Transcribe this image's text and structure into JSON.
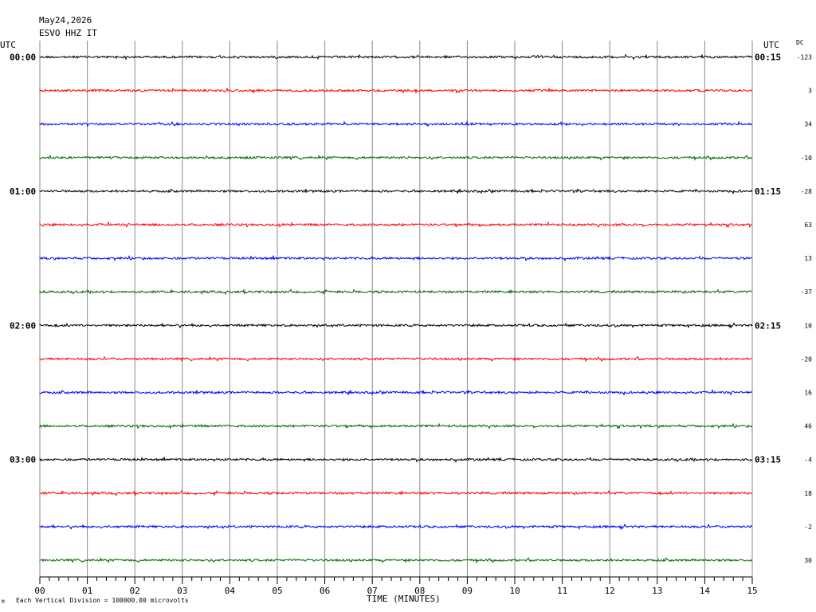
{
  "header": {
    "date": "May24,2026",
    "station": "ESVO HHZ IT",
    "left_tz": "UTC",
    "right_tz": "UTC",
    "dc_label": "DC"
  },
  "footer": {
    "scale_note": "Each Vertical Division = 100000.00 microvolts",
    "corner_mark": "M"
  },
  "chart_data": {
    "type": "line",
    "title": "ESVO HHZ IT",
    "xlabel": "TIME (MINUTES)",
    "ylabel": "",
    "xlim": [
      0,
      15
    ],
    "x_ticks": [
      "00",
      "01",
      "02",
      "03",
      "04",
      "05",
      "06",
      "07",
      "08",
      "09",
      "10",
      "11",
      "12",
      "13",
      "14",
      "15"
    ],
    "trace_colors": [
      "#000000",
      "#ff0000",
      "#0000ff",
      "#006400"
    ],
    "grid": true,
    "rows": [
      {
        "left_label": "00:00",
        "right_label": "00:15",
        "dc": "-123"
      },
      {
        "left_label": "",
        "right_label": "",
        "dc": "3"
      },
      {
        "left_label": "",
        "right_label": "",
        "dc": "34"
      },
      {
        "left_label": "",
        "right_label": "",
        "dc": "-10"
      },
      {
        "left_label": "01:00",
        "right_label": "01:15",
        "dc": "-28"
      },
      {
        "left_label": "",
        "right_label": "",
        "dc": "63"
      },
      {
        "left_label": "",
        "right_label": "",
        "dc": "13"
      },
      {
        "left_label": "",
        "right_label": "",
        "dc": "-37"
      },
      {
        "left_label": "02:00",
        "right_label": "02:15",
        "dc": "10"
      },
      {
        "left_label": "",
        "right_label": "",
        "dc": "-20"
      },
      {
        "left_label": "",
        "right_label": "",
        "dc": "16"
      },
      {
        "left_label": "",
        "right_label": "",
        "dc": "46"
      },
      {
        "left_label": "03:00",
        "right_label": "03:15",
        "dc": "-4"
      },
      {
        "left_label": "",
        "right_label": "",
        "dc": "18"
      },
      {
        "left_label": "",
        "right_label": "",
        "dc": "-2"
      },
      {
        "left_label": "",
        "right_label": "",
        "dc": "30"
      }
    ]
  }
}
